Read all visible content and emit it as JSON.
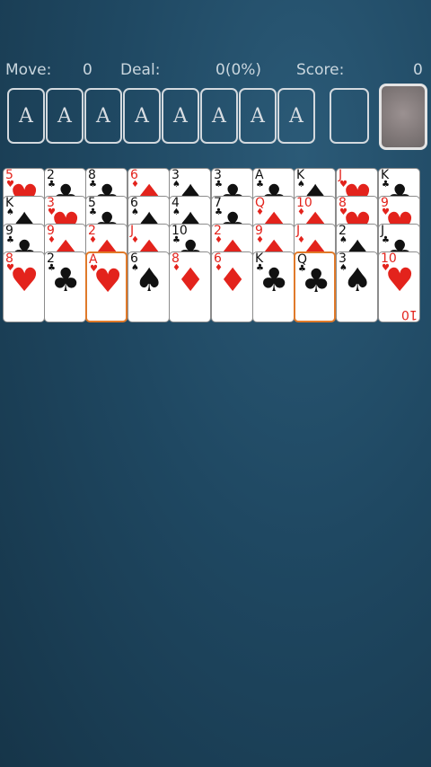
{
  "status": {
    "moves_label": "Move:",
    "moves_value": "0",
    "deal_label": "Deal:",
    "deal_value": "0(0%)",
    "score_label": "Score:",
    "score_value": "0"
  },
  "foundations": [
    "A",
    "A",
    "A",
    "A",
    "A",
    "A",
    "A",
    "A"
  ],
  "columns": [
    [
      {
        "r": "5",
        "s": "♥",
        "c": "red"
      },
      {
        "r": "K",
        "s": "♠",
        "c": "black"
      },
      {
        "r": "9",
        "s": "♣",
        "c": "black"
      },
      {
        "r": "8",
        "s": "♥",
        "c": "red"
      }
    ],
    [
      {
        "r": "2",
        "s": "♣",
        "c": "black"
      },
      {
        "r": "3",
        "s": "♥",
        "c": "red"
      },
      {
        "r": "9",
        "s": "♦",
        "c": "red"
      },
      {
        "r": "2",
        "s": "♣",
        "c": "black"
      }
    ],
    [
      {
        "r": "8",
        "s": "♣",
        "c": "black"
      },
      {
        "r": "5",
        "s": "♣",
        "c": "black"
      },
      {
        "r": "2",
        "s": "♦",
        "c": "red"
      },
      {
        "r": "A",
        "s": "♥",
        "c": "red",
        "sel": true
      }
    ],
    [
      {
        "r": "6",
        "s": "♦",
        "c": "red"
      },
      {
        "r": "6",
        "s": "♠",
        "c": "black"
      },
      {
        "r": "J",
        "s": "♦",
        "c": "red"
      },
      {
        "r": "6",
        "s": "♠",
        "c": "black"
      }
    ],
    [
      {
        "r": "3",
        "s": "♠",
        "c": "black"
      },
      {
        "r": "4",
        "s": "♠",
        "c": "black"
      },
      {
        "r": "10",
        "s": "♣",
        "c": "black"
      },
      {
        "r": "8",
        "s": "♦",
        "c": "red"
      }
    ],
    [
      {
        "r": "3",
        "s": "♣",
        "c": "black"
      },
      {
        "r": "7",
        "s": "♣",
        "c": "black"
      },
      {
        "r": "2",
        "s": "♦",
        "c": "red"
      },
      {
        "r": "6",
        "s": "♦",
        "c": "red"
      }
    ],
    [
      {
        "r": "A",
        "s": "♣",
        "c": "black"
      },
      {
        "r": "Q",
        "s": "♦",
        "c": "red"
      },
      {
        "r": "9",
        "s": "♦",
        "c": "red"
      },
      {
        "r": "K",
        "s": "♣",
        "c": "black"
      }
    ],
    [
      {
        "r": "K",
        "s": "♠",
        "c": "black"
      },
      {
        "r": "10",
        "s": "♦",
        "c": "red"
      },
      {
        "r": "J",
        "s": "♦",
        "c": "red"
      },
      {
        "r": "Q",
        "s": "♣",
        "c": "black",
        "sel": true
      }
    ],
    [
      {
        "r": "J",
        "s": "♥",
        "c": "red"
      },
      {
        "r": "8",
        "s": "♥",
        "c": "red"
      },
      {
        "r": "2",
        "s": "♠",
        "c": "black"
      },
      {
        "r": "3",
        "s": "♠",
        "c": "black"
      }
    ],
    [
      {
        "r": "K",
        "s": "♣",
        "c": "black"
      },
      {
        "r": "9",
        "s": "♥",
        "c": "red"
      },
      {
        "r": "J",
        "s": "♣",
        "c": "black"
      },
      {
        "r": "10",
        "s": "♥",
        "c": "red"
      }
    ]
  ],
  "colors": {
    "table": "#1f4862",
    "red": "#e3231c",
    "black": "#111111",
    "selected": "#e07a2a"
  }
}
